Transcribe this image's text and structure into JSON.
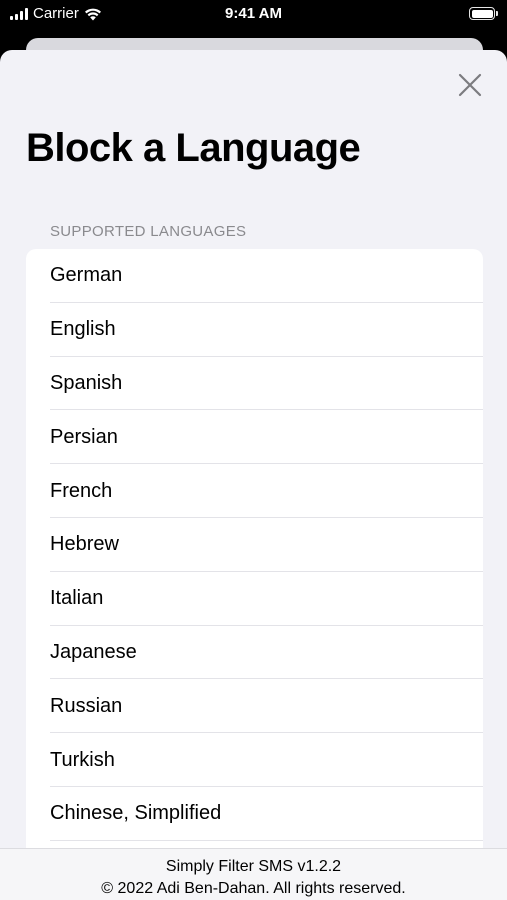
{
  "status_bar": {
    "carrier": "Carrier",
    "time": "9:41 AM"
  },
  "sheet": {
    "title": "Block a Language",
    "section_header": "SUPPORTED LANGUAGES",
    "languages": [
      "German",
      "English",
      "Spanish",
      "Persian",
      "French",
      "Hebrew",
      "Italian",
      "Japanese",
      "Russian",
      "Turkish",
      "Chinese, Simplified"
    ]
  },
  "footer": {
    "version": "Simply Filter SMS v1.2.2",
    "copyright": "© 2022 Adi Ben-Dahan. All rights reserved."
  },
  "colors": {
    "background": "#f2f2f7",
    "section_header": "#8a8a8e",
    "separator": "#e3e3e8"
  }
}
